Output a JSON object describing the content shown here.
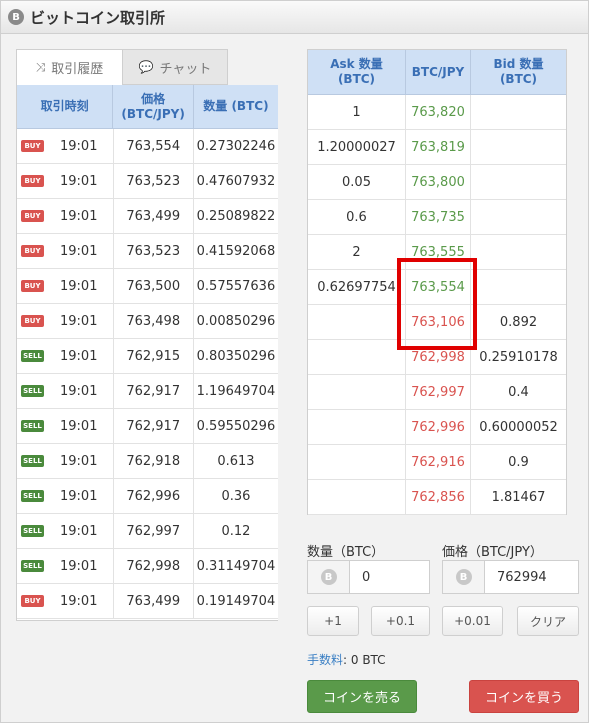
{
  "header": {
    "title": "ビットコイン取引所",
    "coin_icon": "B"
  },
  "tabs": [
    {
      "label": "取引履歴",
      "icon": "shuffle-icon"
    },
    {
      "label": "チャット",
      "icon": "chat-icon"
    }
  ],
  "trades": {
    "headers": [
      "取引時刻",
      "価格\n(BTC/JPY)",
      "数量 (BTC)"
    ],
    "rows": [
      {
        "side": "BUY",
        "time": "19:01",
        "price": "763,554",
        "qty": "0.27302246"
      },
      {
        "side": "BUY",
        "time": "19:01",
        "price": "763,523",
        "qty": "0.47607932"
      },
      {
        "side": "BUY",
        "time": "19:01",
        "price": "763,499",
        "qty": "0.25089822"
      },
      {
        "side": "BUY",
        "time": "19:01",
        "price": "763,523",
        "qty": "0.41592068"
      },
      {
        "side": "BUY",
        "time": "19:01",
        "price": "763,500",
        "qty": "0.57557636"
      },
      {
        "side": "BUY",
        "time": "19:01",
        "price": "763,498",
        "qty": "0.00850296"
      },
      {
        "side": "SELL",
        "time": "19:01",
        "price": "762,915",
        "qty": "0.80350296"
      },
      {
        "side": "SELL",
        "time": "19:01",
        "price": "762,917",
        "qty": "1.19649704"
      },
      {
        "side": "SELL",
        "time": "19:01",
        "price": "762,917",
        "qty": "0.59550296"
      },
      {
        "side": "SELL",
        "time": "19:01",
        "price": "762,918",
        "qty": "0.613"
      },
      {
        "side": "SELL",
        "time": "19:01",
        "price": "762,996",
        "qty": "0.36"
      },
      {
        "side": "SELL",
        "time": "19:01",
        "price": "762,997",
        "qty": "0.12"
      },
      {
        "side": "SELL",
        "time": "19:01",
        "price": "762,998",
        "qty": "0.31149704"
      },
      {
        "side": "BUY",
        "time": "19:01",
        "price": "763,499",
        "qty": "0.19149704"
      }
    ]
  },
  "orderbook": {
    "headers": [
      "Ask 数量\n(BTC)",
      "BTC/JPY",
      "Bid 数量\n(BTC)"
    ],
    "rows": [
      {
        "ask": "1",
        "price": "763,820",
        "bid": "",
        "side": "ask"
      },
      {
        "ask": "1.20000027",
        "price": "763,819",
        "bid": "",
        "side": "ask"
      },
      {
        "ask": "0.05",
        "price": "763,800",
        "bid": "",
        "side": "ask"
      },
      {
        "ask": "0.6",
        "price": "763,735",
        "bid": "",
        "side": "ask"
      },
      {
        "ask": "2",
        "price": "763,555",
        "bid": "",
        "side": "ask"
      },
      {
        "ask": "0.62697754",
        "price": "763,554",
        "bid": "",
        "side": "ask"
      },
      {
        "ask": "",
        "price": "763,106",
        "bid": "0.892",
        "side": "bid"
      },
      {
        "ask": "",
        "price": "762,998",
        "bid": "0.25910178",
        "side": "bid"
      },
      {
        "ask": "",
        "price": "762,997",
        "bid": "0.4",
        "side": "bid"
      },
      {
        "ask": "",
        "price": "762,996",
        "bid": "0.60000052",
        "side": "bid"
      },
      {
        "ask": "",
        "price": "762,916",
        "bid": "0.9",
        "side": "bid"
      },
      {
        "ask": "",
        "price": "762,856",
        "bid": "1.81467",
        "side": "bid"
      }
    ]
  },
  "form": {
    "qty_label": "数量（BTC）",
    "qty_value": "0",
    "price_label": "価格（BTC/JPY）",
    "price_value": "762994",
    "qty_buttons": [
      "+1",
      "+0.1"
    ],
    "price_buttons": [
      "+0.01",
      "クリア"
    ],
    "fee_label": "手数料",
    "fee_value": ": 0 BTC",
    "sell_label": "コインを売る",
    "buy_label": "コインを買う"
  },
  "colors": {
    "buy": "#d9534f",
    "sell": "#4a8a3c",
    "ask_price": "#5a9a4a",
    "bid_price": "#d9534f",
    "header_blue": "#3a6fb5",
    "highlight": "#e00000"
  }
}
